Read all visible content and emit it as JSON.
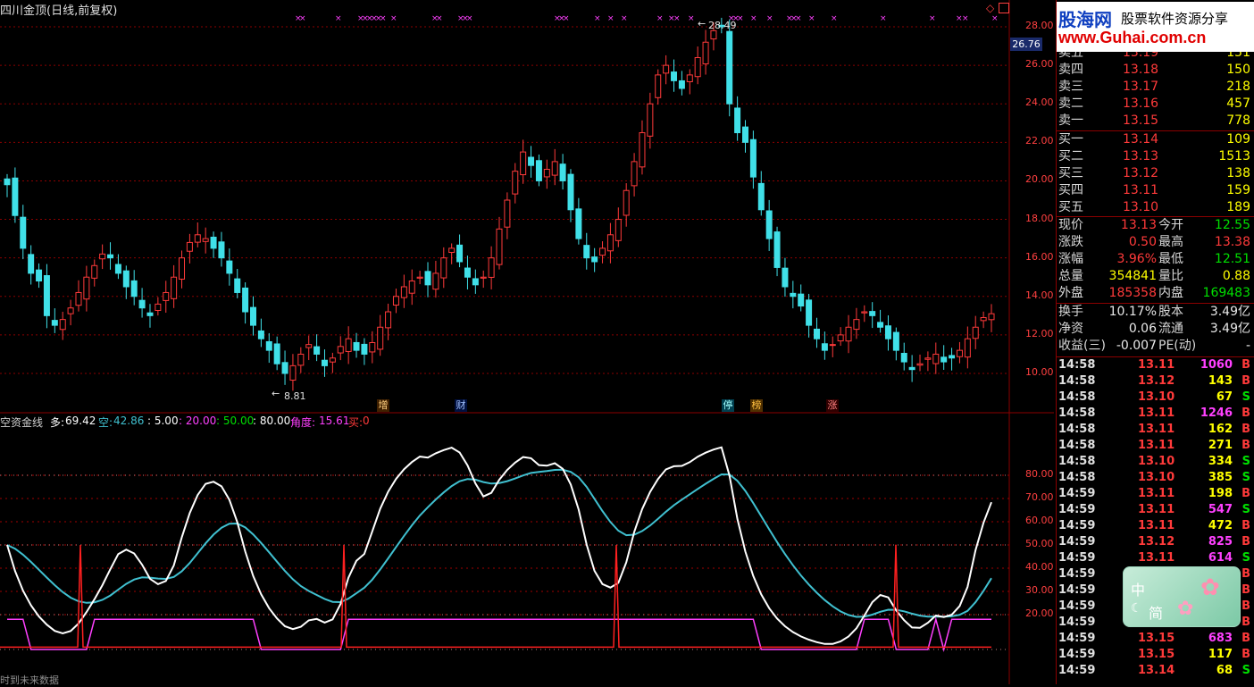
{
  "chart_title": "四川金顶(日线,前复权)",
  "price_axis": {
    "ticks": [
      "28.00",
      "26.00",
      "24.00",
      "22.00",
      "20.00",
      "18.00",
      "16.00",
      "14.00",
      "12.00",
      "10.00"
    ],
    "current_marker": "26.76"
  },
  "candles_annotations": {
    "high_label": "28.49",
    "low_label": "8.81"
  },
  "event_markers": [
    "增",
    "财",
    "停",
    "榜",
    "涨"
  ],
  "indicator": {
    "name": "空资金线",
    "duo_label": "多:",
    "duo_value": "69.42",
    "kong_label": "空:",
    "kong_value": "42.86",
    "v5": ": 5.00",
    "v20": ": 20.00",
    "v50": ": 50.00",
    "v80": ": 80.00",
    "angle_label": "角度:",
    "angle_value": "15.61",
    "buy_label": "买:",
    "buy_value": "0",
    "axis_ticks": [
      "80.00",
      "70.00",
      "60.00",
      "50.00",
      "40.00",
      "30.00",
      "20.00"
    ],
    "footer": "时到未来数据"
  },
  "chart_data": {
    "type": "candlestick",
    "title": "四川金顶(日线,前复权)",
    "ylim": [
      9,
      28.5
    ],
    "price_note": "approx daily closes (estimated)",
    "closes": [
      19.8,
      18.2,
      16.5,
      15.2,
      14.8,
      13.0,
      12.5,
      12.8,
      13.4,
      14.2,
      15.0,
      15.6,
      16.2,
      16.0,
      15.2,
      14.5,
      14.0,
      13.4,
      13.0,
      13.6,
      14.2,
      15.0,
      16.0,
      16.8,
      17.2,
      17.0,
      16.5,
      16.0,
      15.2,
      14.2,
      13.2,
      12.5,
      11.8,
      11.2,
      10.5,
      10.0,
      10.4,
      11.0,
      11.5,
      11.0,
      10.4,
      10.8,
      11.4,
      11.8,
      11.2,
      11.0,
      11.6,
      12.4,
      13.2,
      14.0,
      14.5,
      14.8,
      15.0,
      14.6,
      15.2,
      16.0,
      16.5,
      15.8,
      15.0,
      14.6,
      15.0,
      16.0,
      17.5,
      19.0,
      20.5,
      21.5,
      20.8,
      20.0,
      20.6,
      21.0,
      20.0,
      18.5,
      17.0,
      16.0,
      15.8,
      16.5,
      17.2,
      18.0,
      19.5,
      21.0,
      22.5,
      24.0,
      25.5,
      26.0,
      25.2,
      24.8,
      25.5,
      26.4,
      27.2,
      27.8,
      28.0,
      24.0,
      22.5,
      22.0,
      20.2,
      18.5,
      17.0,
      15.5,
      14.5,
      14.0,
      13.5,
      12.5,
      11.8,
      11.2,
      11.5,
      12.0,
      12.4,
      12.8,
      13.2,
      13.0,
      12.4,
      11.8,
      11.2,
      10.6,
      10.2,
      10.5,
      10.8,
      11.0,
      10.6,
      10.8,
      11.2,
      11.8,
      12.4,
      12.9,
      13.1
    ],
    "indicator_series": [
      {
        "name": "多",
        "color": "#ffffff",
        "range": [
          0,
          100
        ]
      },
      {
        "name": "空",
        "color": "#40c0d0",
        "range": [
          0,
          100
        ]
      }
    ]
  },
  "quote": {
    "sell_rows": [
      {
        "label": "卖五",
        "price": "13.19",
        "vol": "151"
      },
      {
        "label": "卖四",
        "price": "13.18",
        "vol": "150"
      },
      {
        "label": "卖三",
        "price": "13.17",
        "vol": "218"
      },
      {
        "label": "卖二",
        "price": "13.16",
        "vol": "457"
      },
      {
        "label": "卖一",
        "price": "13.15",
        "vol": "778"
      }
    ],
    "buy_rows": [
      {
        "label": "买一",
        "price": "13.14",
        "vol": "109"
      },
      {
        "label": "买二",
        "price": "13.13",
        "vol": "1513"
      },
      {
        "label": "买三",
        "price": "13.12",
        "vol": "138"
      },
      {
        "label": "买四",
        "price": "13.11",
        "vol": "159"
      },
      {
        "label": "买五",
        "price": "13.10",
        "vol": "189"
      }
    ],
    "stats_left": [
      {
        "label": "现价",
        "value": "13.13",
        "color": "red"
      },
      {
        "label": "涨跌",
        "value": "0.50",
        "color": "red"
      },
      {
        "label": "涨幅",
        "value": "3.96%",
        "color": "red"
      },
      {
        "label": "总量",
        "value": "354841",
        "color": "yellow"
      },
      {
        "label": "外盘",
        "value": "185358",
        "color": "red"
      }
    ],
    "stats_right": [
      {
        "label": "今开",
        "value": "12.55",
        "color": "green"
      },
      {
        "label": "最高",
        "value": "13.38",
        "color": "red"
      },
      {
        "label": "最低",
        "value": "12.51",
        "color": "green"
      },
      {
        "label": "量比",
        "value": "0.88",
        "color": "yellow"
      },
      {
        "label": "内盘",
        "value": "169483",
        "color": "green"
      }
    ],
    "fund_left": [
      {
        "label": "换手",
        "value": "10.17%"
      },
      {
        "label": "净资",
        "value": "0.06"
      },
      {
        "label": "收益(三)",
        "value": "-0.007"
      }
    ],
    "fund_right": [
      {
        "label": "股本",
        "value": "3.49亿"
      },
      {
        "label": "流通",
        "value": "3.49亿"
      },
      {
        "label": "PE(动)",
        "value": "-"
      }
    ]
  },
  "ticks": [
    {
      "t": "14:58",
      "p": "13.11",
      "v": "1060",
      "bs": "B",
      "vc": "magenta"
    },
    {
      "t": "14:58",
      "p": "13.12",
      "v": "143",
      "bs": "B",
      "vc": "yellow"
    },
    {
      "t": "14:58",
      "p": "13.10",
      "v": "67",
      "bs": "S",
      "vc": "yellow"
    },
    {
      "t": "14:58",
      "p": "13.11",
      "v": "1246",
      "bs": "B",
      "vc": "magenta"
    },
    {
      "t": "14:58",
      "p": "13.11",
      "v": "162",
      "bs": "B",
      "vc": "yellow"
    },
    {
      "t": "14:58",
      "p": "13.11",
      "v": "271",
      "bs": "B",
      "vc": "yellow"
    },
    {
      "t": "14:58",
      "p": "13.10",
      "v": "334",
      "bs": "S",
      "vc": "yellow"
    },
    {
      "t": "14:58",
      "p": "13.10",
      "v": "385",
      "bs": "S",
      "vc": "yellow"
    },
    {
      "t": "14:59",
      "p": "13.11",
      "v": "198",
      "bs": "B",
      "vc": "yellow"
    },
    {
      "t": "14:59",
      "p": "13.11",
      "v": "547",
      "bs": "S",
      "vc": "magenta"
    },
    {
      "t": "14:59",
      "p": "13.11",
      "v": "472",
      "bs": "B",
      "vc": "yellow"
    },
    {
      "t": "14:59",
      "p": "13.12",
      "v": "825",
      "bs": "B",
      "vc": "magenta"
    },
    {
      "t": "14:59",
      "p": "13.11",
      "v": "614",
      "bs": "S",
      "vc": "magenta"
    },
    {
      "t": "14:59",
      "p": "",
      "v": "",
      "bs": "B",
      "vc": "yellow"
    },
    {
      "t": "14:59",
      "p": "",
      "v": "",
      "bs": "B",
      "vc": "yellow"
    },
    {
      "t": "14:59",
      "p": "",
      "v": "",
      "bs": "B",
      "vc": "yellow"
    },
    {
      "t": "14:59",
      "p": "",
      "v": "",
      "bs": "B",
      "vc": "yellow"
    },
    {
      "t": "14:59",
      "p": "13.15",
      "v": "683",
      "bs": "B",
      "vc": "magenta"
    },
    {
      "t": "14:59",
      "p": "13.15",
      "v": "117",
      "bs": "B",
      "vc": "yellow"
    },
    {
      "t": "14:59",
      "p": "13.14",
      "v": "68",
      "bs": "S",
      "vc": "yellow"
    }
  ],
  "watermark": {
    "brand": "股海网",
    "slogan": "股票软件资源分享",
    "url": "www.Guhai.com.cn"
  },
  "float_widget": {
    "mode1": "中",
    "mode2": "简"
  },
  "colors": {
    "up": "#ff3a3a",
    "down": "#40e0e8",
    "grid": "#8b0000",
    "dotted": "#a00000"
  }
}
